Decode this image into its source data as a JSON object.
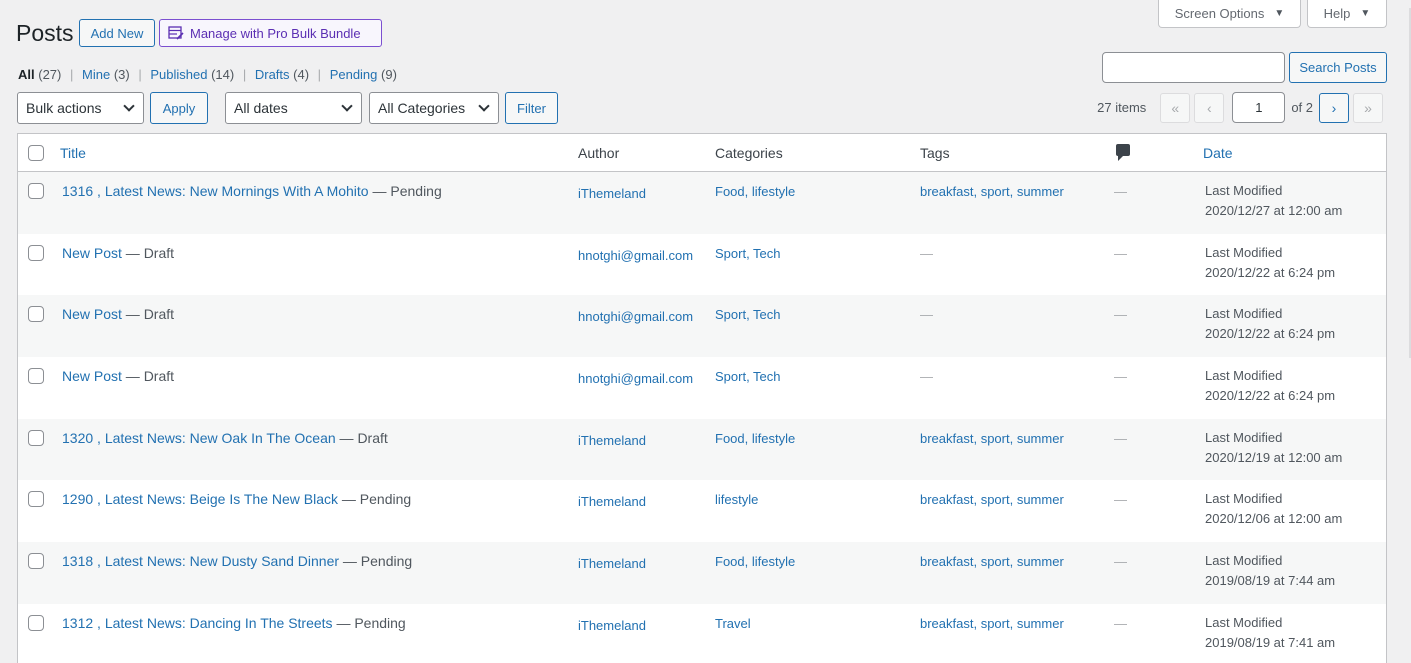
{
  "top_tabs": {
    "screen_options": "Screen Options",
    "help": "Help",
    "caret": "▼"
  },
  "header": {
    "title": "Posts",
    "add_new": "Add New",
    "pro_bulk": "Manage with Pro Bulk Bundle"
  },
  "filters": {
    "all": "All",
    "all_count": "(27)",
    "mine": "Mine",
    "mine_count": "(3)",
    "published": "Published",
    "published_count": "(14)",
    "drafts": "Drafts",
    "drafts_count": "(4)",
    "pending": "Pending",
    "pending_count": "(9)",
    "sep": "|"
  },
  "search": {
    "value": "",
    "button": "Search Posts"
  },
  "toolbar": {
    "bulk_actions": "Bulk actions",
    "apply": "Apply",
    "dates": "All dates",
    "categories": "All Categories",
    "filter": "Filter"
  },
  "pagination": {
    "items": "27 items",
    "first": "«",
    "prev": "‹",
    "current": "1",
    "of": "of 2",
    "next": "›",
    "last": "»"
  },
  "table": {
    "headers": {
      "title": "Title",
      "author": "Author",
      "categories": "Categories",
      "tags": "Tags",
      "date": "Date"
    },
    "rows": [
      {
        "title": "1316 , Latest News: New Mornings With A Mohito",
        "state": " — Pending",
        "author": "iThemeland",
        "cats": "Food, lifestyle",
        "tags": "breakfast, sport, summer",
        "comments": "—",
        "date_label": "Last Modified",
        "date": "2020/12/27 at 12:00 am"
      },
      {
        "title": "New Post",
        "state": " — Draft",
        "author": "hnotghi@gmail.com",
        "cats": "Sport, Tech",
        "tags": "—",
        "comments": "—",
        "date_label": "Last Modified",
        "date": "2020/12/22 at 6:24 pm"
      },
      {
        "title": "New Post",
        "state": " — Draft",
        "author": "hnotghi@gmail.com",
        "cats": "Sport, Tech",
        "tags": "—",
        "comments": "—",
        "date_label": "Last Modified",
        "date": "2020/12/22 at 6:24 pm"
      },
      {
        "title": "New Post",
        "state": " — Draft",
        "author": "hnotghi@gmail.com",
        "cats": "Sport, Tech",
        "tags": "—",
        "comments": "—",
        "date_label": "Last Modified",
        "date": "2020/12/22 at 6:24 pm"
      },
      {
        "title": "1320 , Latest News: New Oak In The Ocean",
        "state": " — Draft",
        "author": "iThemeland",
        "cats": "Food, lifestyle",
        "tags": "breakfast, sport, summer",
        "comments": "—",
        "date_label": "Last Modified",
        "date": "2020/12/19 at 12:00 am"
      },
      {
        "title": "1290 , Latest News: Beige Is The New Black",
        "state": " — Pending",
        "author": "iThemeland",
        "cats": "lifestyle",
        "tags": "breakfast, sport, summer",
        "comments": "—",
        "date_label": "Last Modified",
        "date": "2020/12/06 at 12:00 am"
      },
      {
        "title": "1318 , Latest News: New Dusty Sand Dinner",
        "state": " — Pending",
        "author": "iThemeland",
        "cats": "Food, lifestyle",
        "tags": "breakfast, sport, summer",
        "comments": "—",
        "date_label": "Last Modified",
        "date": "2019/08/19 at 7:44 am"
      },
      {
        "title": "1312 , Latest News: Dancing In The Streets",
        "state": " — Pending",
        "author": "iThemeland",
        "cats": "Travel",
        "tags": "breakfast, sport, summer",
        "comments": "—",
        "date_label": "Last Modified",
        "date": "2019/08/19 at 7:41 am"
      }
    ]
  }
}
